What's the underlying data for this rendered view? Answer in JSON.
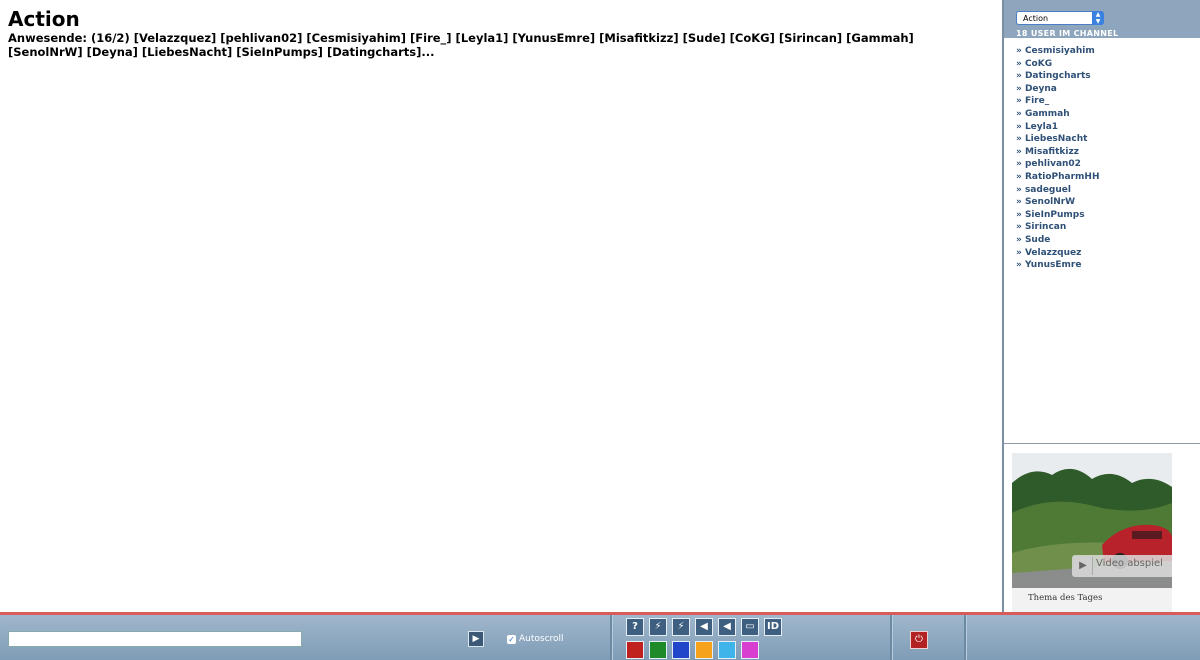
{
  "main": {
    "title": "Action",
    "attendance": "Anwesende: (16/2) [Velazzquez] [pehlivan02] [Cesmisiyahim] [Fire_] [Leyla1] [YunusEmre] [Misafitkizz] [Sude] [CoKG] [Sirincan] [Gammah] [SenolNrW] [Deyna] [LiebesNacht] [SieInPumps] [Datingcharts]..."
  },
  "sidebar": {
    "channel_select": "Action",
    "user_count": "18 USER IM CHANNEL",
    "users": [
      "» Cesmisiyahim",
      "» CoKG",
      "» Datingcharts",
      "» Deyna",
      "» Fire_",
      "» Gammah",
      "» Leyla1",
      "» LiebesNacht",
      "» Misafitkizz",
      "» pehlivan02",
      "» RatioPharmHH",
      "» sadeguel",
      "» SenolNrW",
      "» SieInPumps",
      "» Sirincan",
      "» Sude",
      "» Velazzquez",
      "» YunusEmre"
    ]
  },
  "ad": {
    "play_label": "Video abspiel",
    "caption": "Thema des Tages"
  },
  "toolbar": {
    "message_value": "",
    "autoscroll_label": "Autoscroll",
    "autoscroll_checked": true,
    "tools": [
      {
        "icon": "help-icon",
        "glyph": "?"
      },
      {
        "icon": "smiley-icon",
        "glyph": "⚡"
      },
      {
        "icon": "smiley-off-icon",
        "glyph": "⚡"
      },
      {
        "icon": "sound-icon",
        "glyph": "◀"
      },
      {
        "icon": "sound-off-icon",
        "glyph": "◀"
      },
      {
        "icon": "window-icon",
        "glyph": "▭"
      },
      {
        "icon": "id-icon",
        "glyph": "ID"
      }
    ],
    "colors": [
      "#c0201e",
      "#1f8a2a",
      "#2246c9",
      "#f6a21a",
      "#3fb4ea",
      "#d83fd0"
    ],
    "accent": "#d85a5a"
  }
}
